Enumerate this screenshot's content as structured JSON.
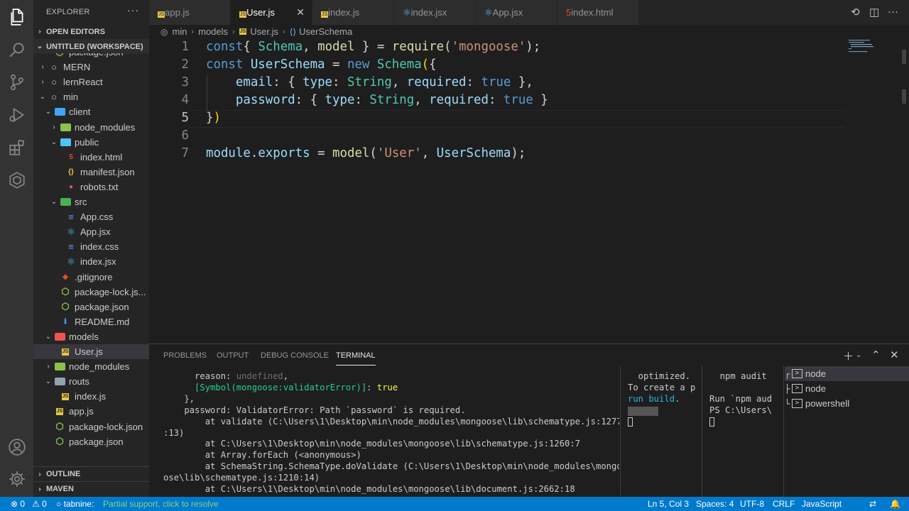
{
  "activity_bar": {
    "icons": [
      "files-icon",
      "search-icon",
      "source-control-icon",
      "run-debug-icon",
      "extensions-icon",
      "remote-explorer-icon",
      "accounts-icon",
      "settings-gear-icon"
    ]
  },
  "sidebar": {
    "title": "EXPLORER",
    "more": "···",
    "sections": {
      "open_editors": "OPEN EDITORS",
      "workspace": "UNTITLED (WORKSPACE)",
      "outline": "OUTLINE",
      "maven": "MAVEN"
    },
    "tree": [
      {
        "label": "package.json",
        "indent": 2,
        "twisty": "",
        "icon": "json"
      },
      {
        "label": "MERN",
        "indent": 1,
        "twisty": "›",
        "icon": "repo"
      },
      {
        "label": "lernReact",
        "indent": 1,
        "twisty": "›",
        "icon": "repo"
      },
      {
        "label": "min",
        "indent": 1,
        "twisty": "⌄",
        "icon": "repo"
      },
      {
        "label": "client",
        "indent": 2,
        "twisty": "⌄",
        "icon": "folder-client"
      },
      {
        "label": "node_modules",
        "indent": 3,
        "twisty": "›",
        "icon": "folder-node"
      },
      {
        "label": "public",
        "indent": 3,
        "twisty": "⌄",
        "icon": "folder-public"
      },
      {
        "label": "index.html",
        "indent": 4,
        "twisty": "",
        "icon": "html"
      },
      {
        "label": "manifest.json",
        "indent": 4,
        "twisty": "",
        "icon": "manifest"
      },
      {
        "label": "robots.txt",
        "indent": 4,
        "twisty": "",
        "icon": "robots"
      },
      {
        "label": "src",
        "indent": 3,
        "twisty": "⌄",
        "icon": "folder-src"
      },
      {
        "label": "App.css",
        "indent": 4,
        "twisty": "",
        "icon": "css"
      },
      {
        "label": "App.jsx",
        "indent": 4,
        "twisty": "",
        "icon": "react"
      },
      {
        "label": "index.css",
        "indent": 4,
        "twisty": "",
        "icon": "css"
      },
      {
        "label": "index.jsx",
        "indent": 4,
        "twisty": "",
        "icon": "react"
      },
      {
        "label": ".gitignore",
        "indent": 3,
        "twisty": "",
        "icon": "git"
      },
      {
        "label": "package-lock.js...",
        "indent": 3,
        "twisty": "",
        "icon": "node"
      },
      {
        "label": "package.json",
        "indent": 3,
        "twisty": "",
        "icon": "node"
      },
      {
        "label": "README.md",
        "indent": 3,
        "twisty": "",
        "icon": "info"
      },
      {
        "label": "models",
        "indent": 2,
        "twisty": "⌄",
        "icon": "folder-models"
      },
      {
        "label": "User.js",
        "indent": 3,
        "twisty": "",
        "icon": "js",
        "selected": true
      },
      {
        "label": "node_modules",
        "indent": 2,
        "twisty": "›",
        "icon": "folder-node"
      },
      {
        "label": "routs",
        "indent": 2,
        "twisty": "⌄",
        "icon": "folder-gray"
      },
      {
        "label": "index.js",
        "indent": 3,
        "twisty": "",
        "icon": "js"
      },
      {
        "label": "app.js",
        "indent": 2,
        "twisty": "",
        "icon": "js"
      },
      {
        "label": "package-lock.json",
        "indent": 2,
        "twisty": "",
        "icon": "node"
      },
      {
        "label": "package.json",
        "indent": 2,
        "twisty": "",
        "icon": "node"
      }
    ]
  },
  "tabs": [
    {
      "label": "app.js",
      "icon": "js",
      "active": false
    },
    {
      "label": "User.js",
      "icon": "js",
      "active": true
    },
    {
      "label": "index.js",
      "icon": "js",
      "active": false
    },
    {
      "label": "index.jsx",
      "icon": "react",
      "active": false
    },
    {
      "label": "App.jsx",
      "icon": "react",
      "active": false
    },
    {
      "label": "index.html",
      "icon": "html",
      "active": false
    }
  ],
  "breadcrumb": [
    "min",
    "models",
    "User.js",
    "UserSchema"
  ],
  "editor": {
    "line_numbers": [
      "1",
      "2",
      "3",
      "4",
      "5",
      "6",
      "7"
    ],
    "current_line": "5",
    "lines": [
      [
        [
          "k",
          "const"
        ],
        [
          "",
          "{ "
        ],
        [
          "t",
          "Schema"
        ],
        [
          "",
          ", "
        ],
        [
          "f",
          "model"
        ],
        [
          "",
          " } = "
        ],
        [
          "f",
          "require"
        ],
        [
          "",
          "("
        ],
        [
          "s",
          "'mongoose'"
        ],
        [
          "",
          ");"
        ]
      ],
      [
        [
          "k",
          "const"
        ],
        [
          "",
          ""
        ],
        [
          "v",
          " UserSchema"
        ],
        [
          "",
          " = "
        ],
        [
          "k",
          "new"
        ],
        [
          "",
          ""
        ],
        [
          "t",
          " Schema"
        ],
        [
          "p",
          "("
        ],
        [
          "",
          "{"
        ]
      ],
      [
        [
          "",
          "    "
        ],
        [
          "v",
          "email"
        ],
        [
          "",
          ": { "
        ],
        [
          "v",
          "type"
        ],
        [
          "",
          ": "
        ],
        [
          "t",
          "String"
        ],
        [
          "",
          ", "
        ],
        [
          "v",
          "required"
        ],
        [
          "",
          ": "
        ],
        [
          "k",
          "true"
        ],
        [
          "",
          " },"
        ]
      ],
      [
        [
          "",
          "    "
        ],
        [
          "v",
          "password"
        ],
        [
          "",
          ": { "
        ],
        [
          "v",
          "type"
        ],
        [
          "",
          ": "
        ],
        [
          "t",
          "String"
        ],
        [
          "",
          ", "
        ],
        [
          "v",
          "required"
        ],
        [
          "",
          ": "
        ],
        [
          "k",
          "true"
        ],
        [
          "",
          " }"
        ]
      ],
      [
        [
          "",
          "}"
        ],
        [
          "p",
          ")"
        ]
      ],
      [],
      [
        [
          "v",
          "module"
        ],
        [
          "",
          "."
        ],
        [
          "v",
          "exports"
        ],
        [
          "",
          " = "
        ],
        [
          "f",
          "model"
        ],
        [
          "",
          "("
        ],
        [
          "s",
          "'User'"
        ],
        [
          "",
          ", "
        ],
        [
          "v",
          "UserSchema"
        ],
        [
          "",
          ");"
        ]
      ]
    ]
  },
  "panel": {
    "tabs": [
      "PROBLEMS",
      "OUTPUT",
      "DEBUG CONSOLE",
      "TERMINAL"
    ],
    "active_tab": "TERMINAL",
    "terminal_main": [
      [
        [
          "",
          "      reason: "
        ],
        [
          "gray",
          "undefined"
        ],
        [
          "",
          ","
        ]
      ],
      [
        [
          "",
          "      "
        ],
        [
          "grn",
          "[Symbol(mongoose:validatorError)]"
        ],
        [
          "",
          ": "
        ],
        [
          "yel",
          "true"
        ]
      ],
      [
        [
          "",
          "    },"
        ]
      ],
      [
        [
          "",
          "    password: ValidatorError: Path `password` is required."
        ]
      ],
      [
        [
          "",
          "        at validate (C:\\Users\\1\\Desktop\\min\\node_modules\\mongoose\\lib\\schematype.js:1277"
        ]
      ],
      [
        [
          "",
          ":13)"
        ]
      ],
      [
        [
          "",
          "        at C:\\Users\\1\\Desktop\\min\\node_modules\\mongoose\\lib\\schematype.js:1260:7"
        ]
      ],
      [
        [
          "",
          "        at Array.forEach (<anonymous>)"
        ]
      ],
      [
        [
          "",
          "        at SchemaString.SchemaType.doValidate (C:\\Users\\1\\Desktop\\min\\node_modules\\mongo"
        ]
      ],
      [
        [
          "",
          "ose\\lib\\schematype.js:1210:14)"
        ]
      ],
      [
        [
          "",
          "        at C:\\Users\\1\\Desktop\\min\\node_modules\\mongoose\\lib\\document.js:2662:18"
        ]
      ]
    ],
    "terminal_2": [
      [
        [
          "",
          "  optimized."
        ]
      ],
      [
        [
          "",
          "To create a p"
        ]
      ],
      [
        [
          "cyan",
          "run build"
        ],
        [
          "",
          "."
        ]
      ]
    ],
    "terminal_3": [
      [
        [
          "",
          "  npm audit"
        ]
      ],
      [
        [
          "",
          ""
        ]
      ],
      [
        [
          "",
          "Run `npm aud"
        ]
      ],
      [
        [
          "",
          "PS C:\\Users\\"
        ]
      ]
    ],
    "terminal_list": [
      "node",
      "node",
      "powershell"
    ]
  },
  "status_bar": {
    "errors": "0",
    "warnings": "0",
    "tabnine": "tabnine:",
    "tabnine_msg": "Partial support, click to resolve",
    "position": "Ln 5, Col 3",
    "spaces": "Spaces: 4",
    "encoding": "UTF-8",
    "eol": "CRLF",
    "language": "JavaScript"
  },
  "colors": {
    "accent": "#007acc",
    "tabnine_msg": "#89d185",
    "js_icon": "#e8c547",
    "react_icon": "#4fc3f7",
    "html_icon": "#e44d26",
    "css_icon": "#42a5f5"
  }
}
